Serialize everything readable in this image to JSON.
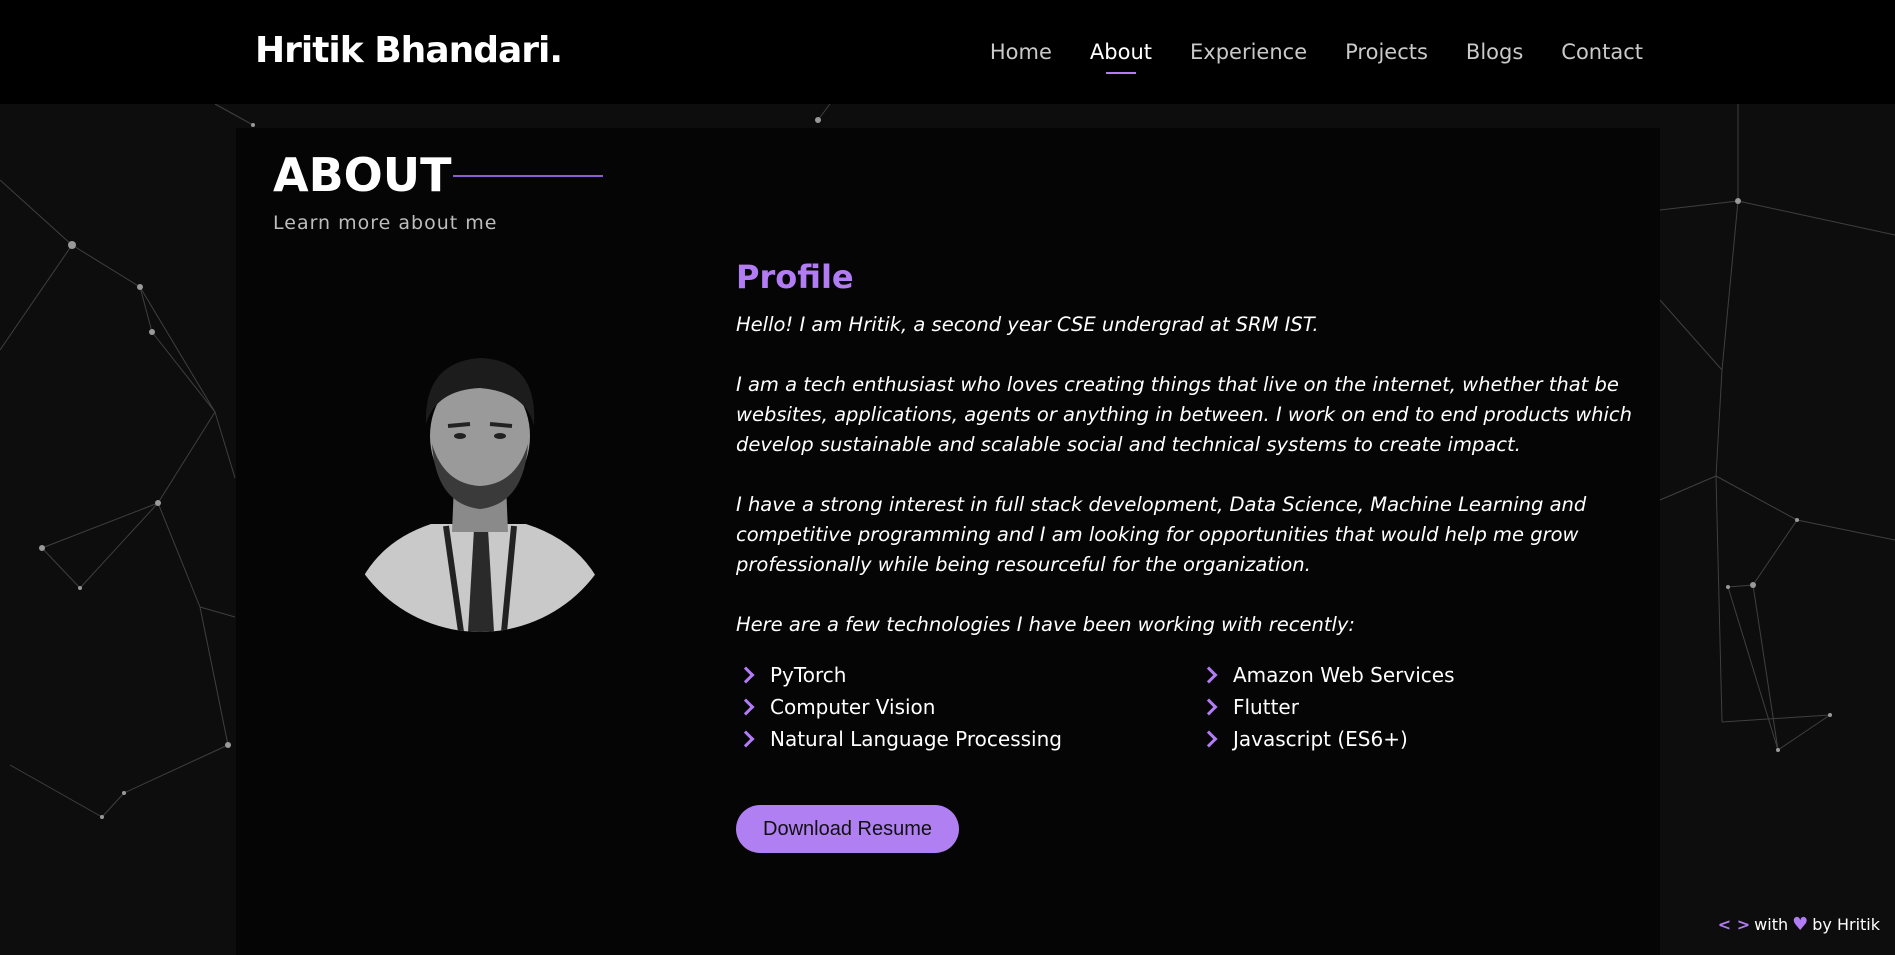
{
  "brand": "Hritik Bhandari.",
  "nav": [
    {
      "label": "Home",
      "active": false
    },
    {
      "label": "About",
      "active": true
    },
    {
      "label": "Experience",
      "active": false
    },
    {
      "label": "Projects",
      "active": false
    },
    {
      "label": "Blogs",
      "active": false
    },
    {
      "label": "Contact",
      "active": false
    }
  ],
  "about": {
    "title": "ABOUT",
    "subtitle": "Learn more about me",
    "profile_title": "Profile",
    "bio": [
      "Hello! I am Hritik, a second year CSE undergrad at SRM IST.",
      "I am a tech enthusiast who loves creating things that live on the internet, whether that be websites, applications, agents or anything in between. I work on end to end products which develop sustainable and scalable social and technical systems to create impact.",
      "I have a strong interest in full stack development, Data Science, Machine Learning and competitive programming and I am looking for opportunities that would help me grow professionally while being resourceful for the organization.",
      "Here are a few technologies I have been working with recently:"
    ],
    "technologies": [
      "PyTorch",
      "Amazon Web Services",
      "Computer Vision",
      "Flutter",
      "Natural Language Processing",
      "Javascript (ES6+)"
    ],
    "resume_button": "Download Resume"
  },
  "footer": {
    "code_icon": "< >",
    "with": "with",
    "heart_icon": "♥",
    "by": "by Hritik"
  },
  "colors": {
    "accent": "#b27cf5",
    "background": "#0d0d0d",
    "card": "#050505"
  },
  "icons": [
    "chevron-right-icon",
    "code-icon",
    "heart-icon"
  ]
}
